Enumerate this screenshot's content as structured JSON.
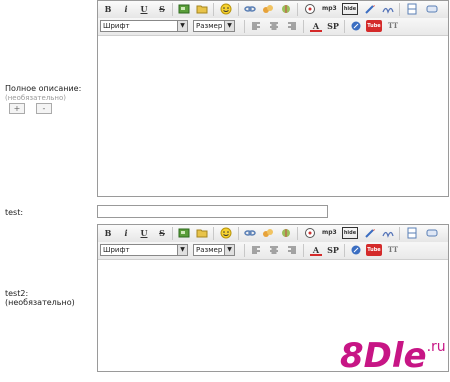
{
  "full_description": {
    "label": "Полное описание:",
    "hint": "(необязательно)",
    "plus_label": "+",
    "minus_label": "-"
  },
  "test_field": {
    "label": "test:",
    "value": ""
  },
  "test2_field": {
    "label": "test2:",
    "hint": "(необязательно)"
  },
  "toolbar": {
    "font_select": "Шрифт",
    "size_select": "Размер",
    "bold": "B",
    "italic": "i",
    "underline": "U",
    "strike": "S",
    "mp3": "mp3",
    "hide": "hide",
    "sp": "SP",
    "tube": "Tube",
    "tt": "TT",
    "color_a": "A"
  },
  "watermark": {
    "brand": "8Dle",
    "suffix": ".ru"
  },
  "colors": {
    "tube_red": "#d42a2a",
    "logo_pink": "#c71585",
    "logo_gray": "#8a8a8a"
  }
}
